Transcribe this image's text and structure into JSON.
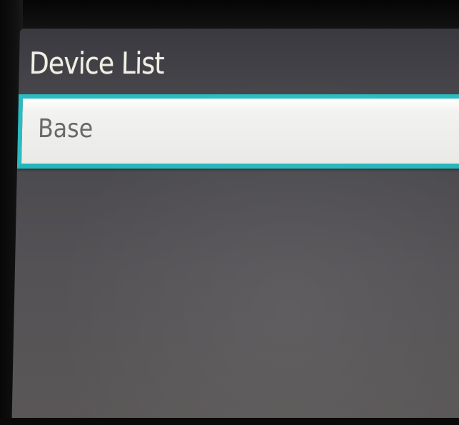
{
  "header": {
    "title": "Device List"
  },
  "device_list": {
    "items": [
      {
        "label": "Base",
        "selected": true
      }
    ]
  },
  "colors": {
    "selection_border": "#2bbcc1",
    "screen_background": "#4a494d",
    "title_text": "#f1eee2",
    "item_text": "#6a6968"
  }
}
